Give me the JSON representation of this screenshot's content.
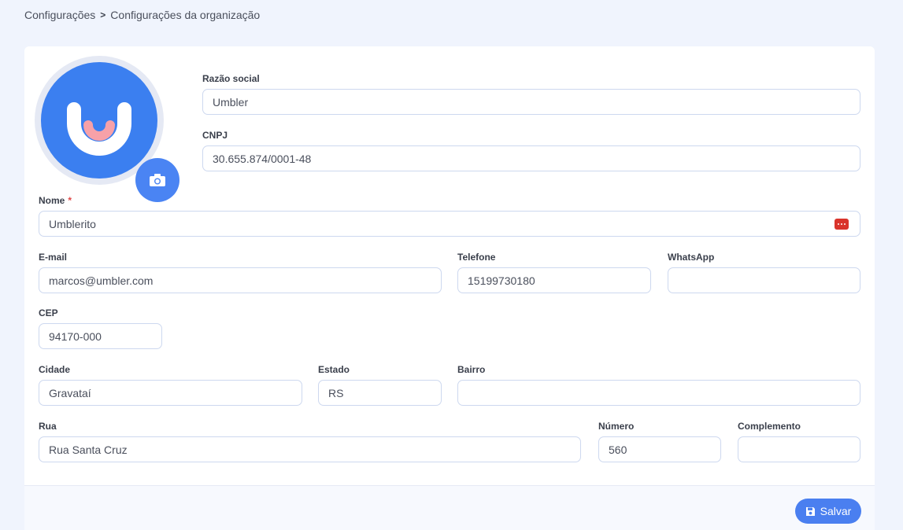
{
  "breadcrumb": {
    "parent": "Configurações",
    "separator": ">",
    "current": "Configurações da organização"
  },
  "avatar": {
    "icon": "umbler-logo-icon",
    "upload_icon": "camera-icon"
  },
  "form": {
    "razao_social": {
      "label": "Razão social",
      "value": "Umbler"
    },
    "cnpj": {
      "label": "CNPJ",
      "value": "30.655.874/0001-48"
    },
    "nome": {
      "label": "Nome",
      "required_mark": "*",
      "value": "Umblerito"
    },
    "email": {
      "label": "E-mail",
      "value": "marcos@umbler.com"
    },
    "telefone": {
      "label": "Telefone",
      "value": "15199730180"
    },
    "whatsapp": {
      "label": "WhatsApp",
      "value": ""
    },
    "cep": {
      "label": "CEP",
      "value": "94170-000"
    },
    "cidade": {
      "label": "Cidade",
      "value": "Gravataí"
    },
    "estado": {
      "label": "Estado",
      "value": "RS"
    },
    "bairro": {
      "label": "Bairro",
      "value": ""
    },
    "rua": {
      "label": "Rua",
      "value": "Rua Santa Cruz"
    },
    "numero": {
      "label": "Número",
      "value": "560"
    },
    "complemento": {
      "label": "Complemento",
      "value": ""
    }
  },
  "footer": {
    "save_label": "Salvar",
    "save_icon": "floppy-disk-icon"
  },
  "colors": {
    "background": "#f0f4fd",
    "accent": "#4a7ff0",
    "logo_pink": "#f7a1a8",
    "error": "#d9342b"
  }
}
